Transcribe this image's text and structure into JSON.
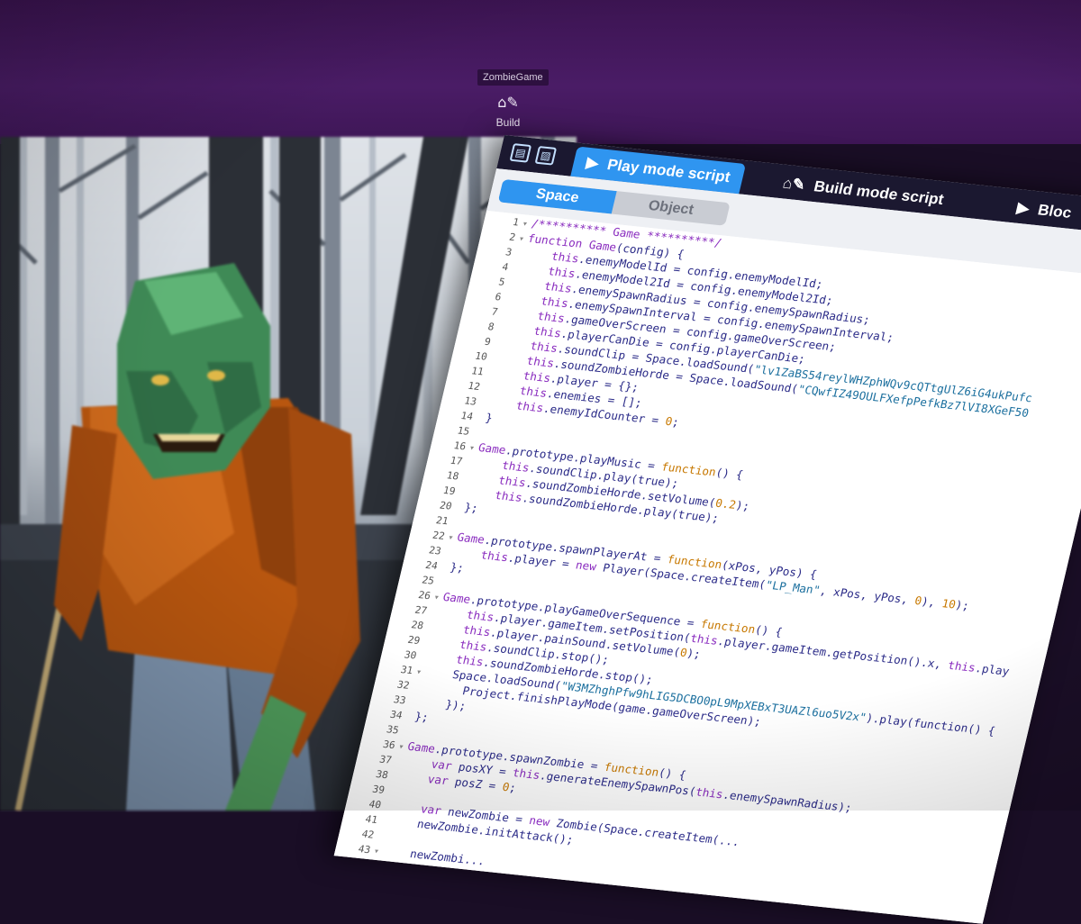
{
  "topbar": {
    "project_name": "ZombieGame",
    "build_label": "Build"
  },
  "tabs": [
    {
      "label": "Play mode script",
      "icon": "play-icon",
      "active": true
    },
    {
      "label": "Build mode script",
      "icon": "build-icon",
      "active": false
    },
    {
      "label": "Bloc",
      "icon": "play-icon",
      "active": false
    }
  ],
  "toggle": {
    "space": "Space",
    "object": "Object",
    "selected": "Space"
  },
  "colors": {
    "topbar": "#4a1c66",
    "accent": "#2f95f0",
    "keyword": "#8a2dbf",
    "function": "#c77800",
    "string": "#1b6f9e"
  },
  "code_lines": [
    {
      "n": "1",
      "fold": "▾",
      "text": "/********** Game **********/"
    },
    {
      "n": "2",
      "fold": "▾",
      "text": "function Game(config) {"
    },
    {
      "n": "3",
      "fold": "",
      "text": "    this.enemyModelId = config.enemyModelId;"
    },
    {
      "n": "4",
      "fold": "",
      "text": "    this.enemyModel2Id = config.enemyModel2Id;"
    },
    {
      "n": "5",
      "fold": "",
      "text": "    this.enemySpawnRadius = config.enemySpawnRadius;"
    },
    {
      "n": "6",
      "fold": "",
      "text": "    this.enemySpawnInterval = config.enemySpawnInterval;"
    },
    {
      "n": "7",
      "fold": "",
      "text": "    this.gameOverScreen = config.gameOverScreen;"
    },
    {
      "n": "8",
      "fold": "",
      "text": "    this.playerCanDie = config.playerCanDie;"
    },
    {
      "n": "9",
      "fold": "",
      "text": "    this.soundClip = Space.loadSound(\"lv1ZaBS54reylWHZphWQv9cQTtgUlZ6iG4ukPufc"
    },
    {
      "n": "10",
      "fold": "",
      "text": "    this.soundZombieHorde = Space.loadSound(\"CQwfIZ49OULFXefpPefkBz7lVI8XGeF50"
    },
    {
      "n": "11",
      "fold": "",
      "text": "    this.player = {};"
    },
    {
      "n": "12",
      "fold": "",
      "text": "    this.enemies = [];"
    },
    {
      "n": "13",
      "fold": "",
      "text": "    this.enemyIdCounter = 0;"
    },
    {
      "n": "14",
      "fold": "",
      "text": "}"
    },
    {
      "n": "15",
      "fold": "",
      "text": ""
    },
    {
      "n": "16",
      "fold": "▾",
      "text": "Game.prototype.playMusic = function() {"
    },
    {
      "n": "17",
      "fold": "",
      "text": "    this.soundClip.play(true);"
    },
    {
      "n": "18",
      "fold": "",
      "text": "    this.soundZombieHorde.setVolume(0.2);"
    },
    {
      "n": "19",
      "fold": "",
      "text": "    this.soundZombieHorde.play(true);"
    },
    {
      "n": "20",
      "fold": "",
      "text": "};"
    },
    {
      "n": "21",
      "fold": "",
      "text": ""
    },
    {
      "n": "22",
      "fold": "▾",
      "text": "Game.prototype.spawnPlayerAt = function(xPos, yPos) {"
    },
    {
      "n": "23",
      "fold": "",
      "text": "    this.player = new Player(Space.createItem(\"LP_Man\", xPos, yPos, 0), 10);"
    },
    {
      "n": "24",
      "fold": "",
      "text": "};"
    },
    {
      "n": "25",
      "fold": "",
      "text": ""
    },
    {
      "n": "26",
      "fold": "▾",
      "text": "Game.prototype.playGameOverSequence = function() {"
    },
    {
      "n": "27",
      "fold": "",
      "text": "    this.player.gameItem.setPosition(this.player.gameItem.getPosition().x, this.play"
    },
    {
      "n": "28",
      "fold": "",
      "text": "    this.player.painSound.setVolume(0);"
    },
    {
      "n": "29",
      "fold": "",
      "text": "    this.soundClip.stop();"
    },
    {
      "n": "30",
      "fold": "",
      "text": "    this.soundZombieHorde.stop();"
    },
    {
      "n": "31",
      "fold": "▾",
      "text": "    Space.loadSound(\"W3MZhghPfw9hLIG5DCBO0pL9MpXEBxT3UAZl6uo5V2x\").play(function() {"
    },
    {
      "n": "32",
      "fold": "",
      "text": "      Project.finishPlayMode(game.gameOverScreen);"
    },
    {
      "n": "33",
      "fold": "",
      "text": "    });"
    },
    {
      "n": "34",
      "fold": "",
      "text": "};"
    },
    {
      "n": "35",
      "fold": "",
      "text": ""
    },
    {
      "n": "36",
      "fold": "▾",
      "text": "Game.prototype.spawnZombie = function() {"
    },
    {
      "n": "37",
      "fold": "",
      "text": "    var posXY = this.generateEnemySpawnPos(this.enemySpawnRadius);"
    },
    {
      "n": "38",
      "fold": "",
      "text": "    var posZ = 0;"
    },
    {
      "n": "39",
      "fold": "",
      "text": ""
    },
    {
      "n": "40",
      "fold": "",
      "text": "    var newZombie = new Zombie(Space.createItem(..."
    },
    {
      "n": "41",
      "fold": "",
      "text": "    newZombie.initAttack();"
    },
    {
      "n": "42",
      "fold": "",
      "text": ""
    },
    {
      "n": "43",
      "fold": "▾",
      "text": "    newZombi..."
    }
  ]
}
